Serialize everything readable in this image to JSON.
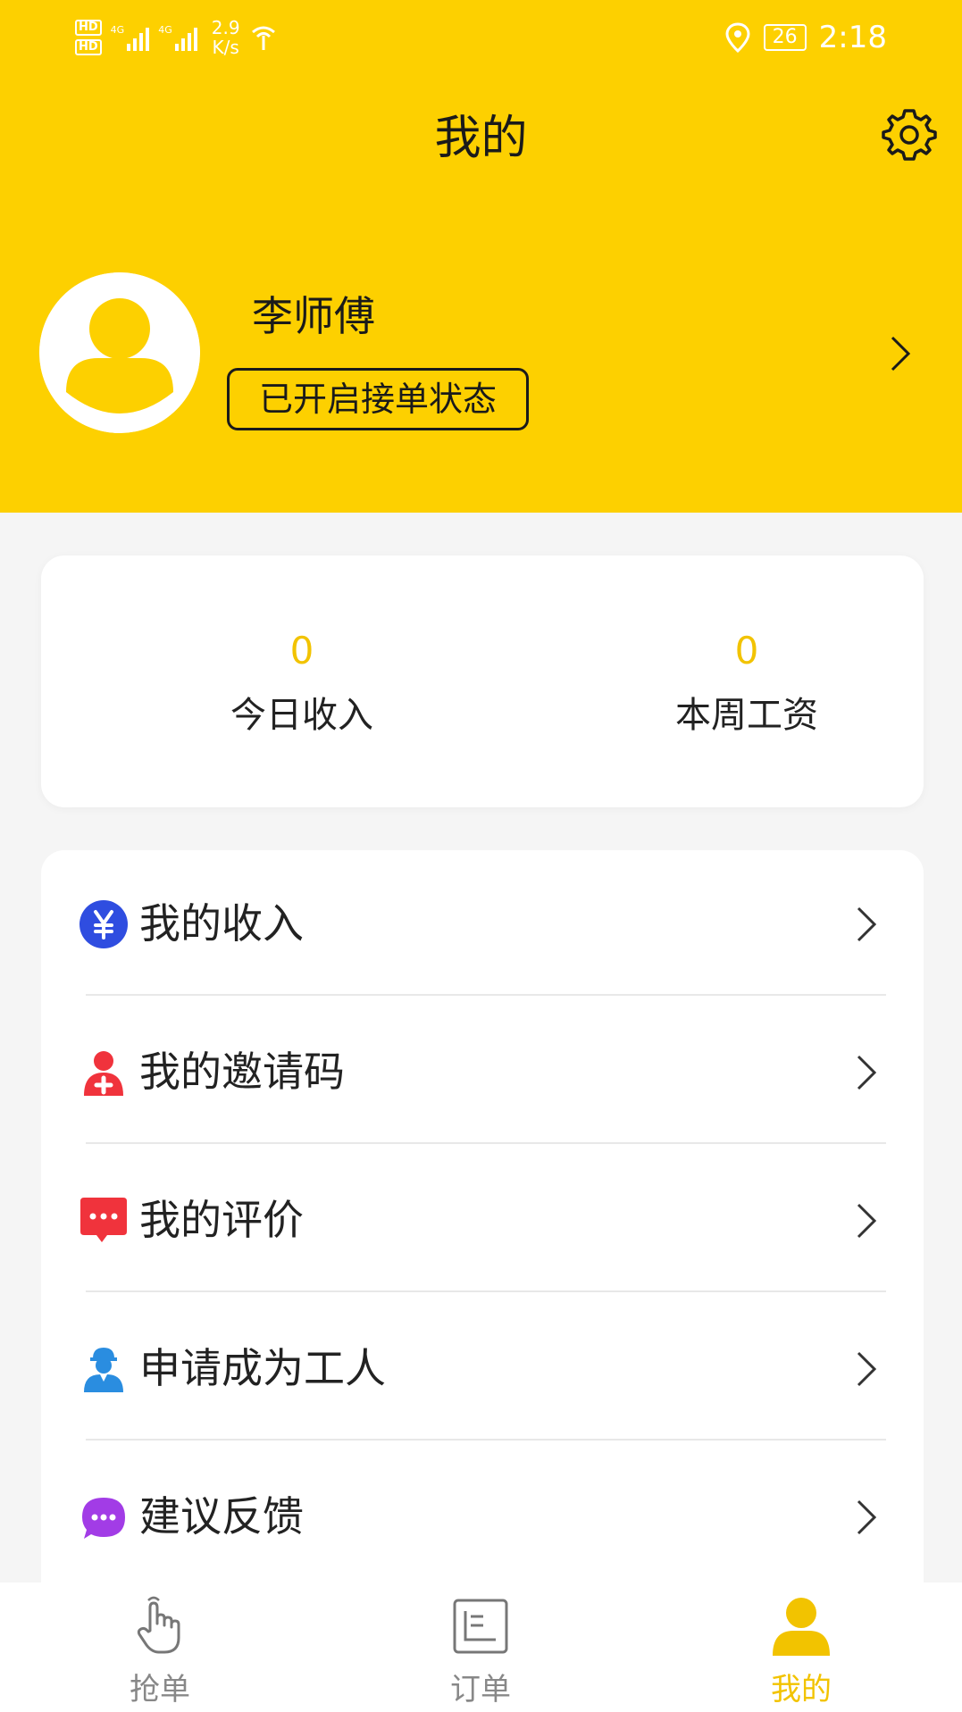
{
  "status_bar": {
    "hd1": "HD",
    "hd2": "HD",
    "net1": "4G",
    "net2": "4G",
    "speed_value": "2.9",
    "speed_unit": "K/s",
    "battery": "26",
    "time": "2:18"
  },
  "header": {
    "title": "我的"
  },
  "profile": {
    "name": "李师傅",
    "status": "已开启接单状态"
  },
  "stats": [
    {
      "value": "0",
      "label": "今日收入"
    },
    {
      "value": "0",
      "label": "本周工资"
    }
  ],
  "menu": [
    {
      "label": "我的收入",
      "icon": "yuan-icon"
    },
    {
      "label": "我的邀请码",
      "icon": "invite-user-icon"
    },
    {
      "label": "我的评价",
      "icon": "comment-icon"
    },
    {
      "label": "申请成为工人",
      "icon": "worker-icon"
    },
    {
      "label": "建议反馈",
      "icon": "feedback-icon"
    }
  ],
  "tabs": [
    {
      "label": "抢单",
      "icon": "hand-tap-icon",
      "active": false
    },
    {
      "label": "订单",
      "icon": "order-list-icon",
      "active": false
    },
    {
      "label": "我的",
      "icon": "person-icon",
      "active": true
    }
  ],
  "colors": {
    "brand_yellow": "#fdd000",
    "stat_value": "#f2c300",
    "yuan_icon": "#2f4de0",
    "invite_icon": "#f0333c",
    "comment_icon": "#f0333c",
    "worker_icon": "#2a8de0",
    "feedback_icon": "#a23ce6"
  }
}
